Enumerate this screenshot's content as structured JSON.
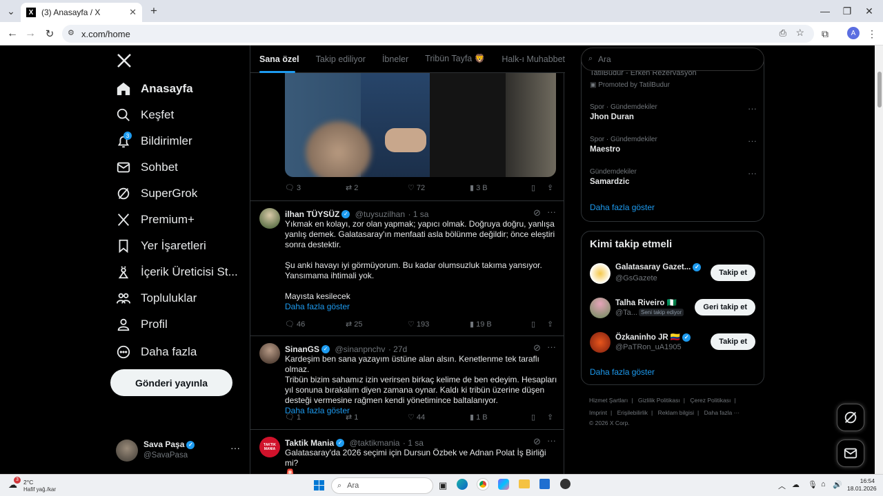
{
  "browser": {
    "tab_title": "(3) Anasayfa / X",
    "url": "x.com/home",
    "profile_initial": "A"
  },
  "sidebar": {
    "items": [
      {
        "label": "Anasayfa",
        "icon": "home-icon"
      },
      {
        "label": "Keşfet",
        "icon": "search-icon"
      },
      {
        "label": "Bildirimler",
        "icon": "bell-icon",
        "badge": "3"
      },
      {
        "label": "Sohbet",
        "icon": "mail-icon"
      },
      {
        "label": "SuperGrok",
        "icon": "grok-icon"
      },
      {
        "label": "Premium+",
        "icon": "x-logo-icon"
      },
      {
        "label": "Yer İşaretleri",
        "icon": "bookmark-icon"
      },
      {
        "label": "İçerik Üreticisi St...",
        "icon": "creator-icon"
      },
      {
        "label": "Topluluklar",
        "icon": "communities-icon"
      },
      {
        "label": "Profil",
        "icon": "profile-icon"
      },
      {
        "label": "Daha fazla",
        "icon": "more-circle-icon"
      }
    ],
    "post_button": "Gönderi yayınla",
    "account": {
      "name": "Sava Paşa",
      "handle": "@SavaPasa"
    }
  },
  "feed": {
    "tabs": [
      "Sana özel",
      "Takip ediliyor",
      "İbneler",
      "Tribün Tayfa 🦁",
      "Halk-ı Muhabbet"
    ],
    "top_actions": {
      "replies": "3",
      "reposts": "2",
      "likes": "72",
      "views": "3 B"
    },
    "tweets": [
      {
        "name": "ilhan TÜYSÜZ",
        "handle": "@tuysuzilhan",
        "time": "· 1 sa",
        "lines": [
          "Yıkmak en kolayı, zor olan yapmak; yapıcı olmak. Doğruya doğru, yanlışa",
          "yanlış demek. Galatasaray'ın menfaati asla bölünme değildir; önce eleştiri",
          "sonra destektir.",
          "",
          "Şu anki havayı iyi görmüyorum. Bu kadar olumsuzluk takıma yansıyor.",
          "Yansımama ihtimali yok.",
          "",
          "Mayısta kesilecek"
        ],
        "more": "Daha fazla göster",
        "replies": "46",
        "reposts": "25",
        "likes": "193",
        "views": "19 B"
      },
      {
        "name": "SinanGS",
        "handle": "@sinanpnchv",
        "time": "· 27d",
        "lines": [
          "Kardeşim ben sana yazayım üstüne alan alsın. Kenetlenme tek taraflı olmaz.",
          "Tribün bizim sahamız izin verirsen birkaç kelime de ben edeyim. Hesapları",
          "yıl sonuna bırakalım diyen zamana oynar. Kaldı ki tribün üzerine düşen",
          "desteği vermesine rağmen kendi yönetimince baltalanıyor."
        ],
        "more": "Daha fazla göster",
        "replies": "1",
        "reposts": "1",
        "likes": "44",
        "views": "1 B"
      },
      {
        "name": "Taktik Mania",
        "handle": "@taktikmania",
        "time": "· 1 sa",
        "avatar_text": "TAKTIK MANIA",
        "lines": [
          "Galatasaray'da 2026 seçimi için Dursun Özbek ve Adnan Polat İş Birliği mi?",
          "🚨"
        ]
      }
    ]
  },
  "right": {
    "search_placeholder": "Ara",
    "promo": {
      "title": "TatilBudur - Erken Rezervasyon",
      "promoted": "Promoted by TatilBudur"
    },
    "trends": [
      {
        "meta": "Spor · Gündemdekiler",
        "name": "Jhon Duran"
      },
      {
        "meta": "Spor · Gündemdekiler",
        "name": "Maestro"
      },
      {
        "meta": "Gündemdekiler",
        "name": "Samardzic"
      }
    ],
    "trends_more": "Daha fazla göster",
    "who_to_follow": {
      "title": "Kimi takip etmeli",
      "users": [
        {
          "name": "Galatasaray Gazet...",
          "handle": "@GsGazete",
          "button": "Takip et",
          "note": ""
        },
        {
          "name": "Talha Riveiro 🇳🇬",
          "handle": "@Ta...",
          "button": "Geri takip et",
          "note": "Seni takip ediyor"
        },
        {
          "name": "Özkaninho JR 🇨🇴",
          "handle": "@PaTRon_uA1905",
          "button": "Takip et",
          "note": ""
        }
      ],
      "more": "Daha fazla göster"
    },
    "footer": {
      "line1": [
        "Hizmet Şartları",
        "Gizlilik Politikası",
        "Çerez Politikası"
      ],
      "line2": [
        "Imprint",
        "Erişilebilirlik",
        "Reklam bilgisi",
        "Daha fazla ···"
      ],
      "copyright": "© 2026 X Corp."
    }
  },
  "taskbar": {
    "weather_temp": "2°C",
    "weather_desc": "Hafif yağ./kar",
    "weather_badge": "3",
    "search": "Ara",
    "time": "16:54",
    "date": "18.01.2026"
  },
  "colors": {
    "accent": "#1d9bf0",
    "background": "#000000",
    "border": "#2f3336",
    "muted": "#71767b"
  }
}
